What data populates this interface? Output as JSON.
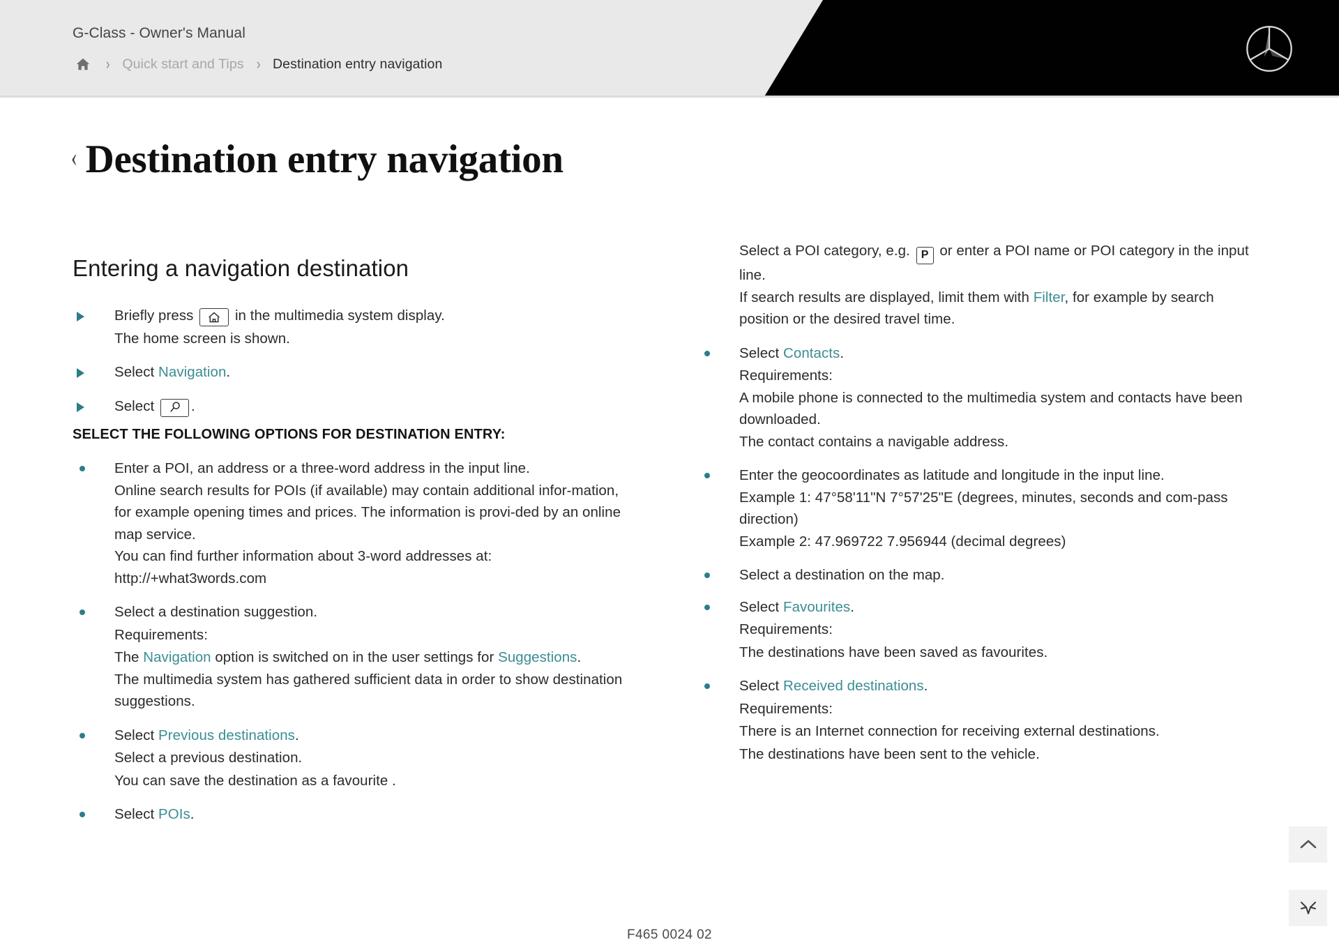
{
  "header": {
    "manual_title": "G-Class - Owner's Manual",
    "breadcrumb": {
      "home_icon": "home-icon",
      "separator": "›",
      "parent": "Quick start and Tips",
      "current": "Destination entry navigation"
    },
    "brand_logo": "mercedes-benz-star-icon"
  },
  "page": {
    "back_chevron": "‹",
    "title": "Destination entry navigation"
  },
  "left_column": {
    "section_heading": "Entering a navigation destination",
    "step1": {
      "prefix": "Briefly press",
      "icon": "home-icon",
      "suffix": "in the multimedia system display.",
      "result": "The home screen is shown."
    },
    "step2": {
      "prefix": "Select",
      "link": "Navigation",
      "period": "."
    },
    "step3": {
      "prefix": "Select",
      "icon": "search-icon",
      "period": "."
    },
    "caps_heading": "SELECT THE FOLLOWING OPTIONS FOR DESTINATION ENTRY:",
    "options": {
      "poi_entry": {
        "line1": "Enter a POI, an address or a three-word address in the input line.",
        "line2": "Online search results for POIs (if available) may contain additional infor-mation, for example opening times and prices. The information is provi-ded by an online map service.",
        "line3": "You can find further information about 3-word addresses at: http://+what3words.com"
      },
      "suggestion": {
        "line1": "Select a destination suggestion.",
        "requirements_label": "Requirements:",
        "req1_before": "The ",
        "req1_link1": "Navigation",
        "req1_middle": " option is switched on in the user settings for ",
        "req1_link2": "Suggestions",
        "req1_after": ".",
        "req2": "The multimedia system has gathered sufficient data in order to show destination suggestions."
      },
      "previous": {
        "prefix": "Select ",
        "link": "Previous destinations",
        "period": ".",
        "line2": "Select a previous destination.",
        "line3": "You can save the destination as a favourite ."
      },
      "pois": {
        "prefix": "Select ",
        "link": "POIs",
        "period": "."
      }
    }
  },
  "right_column": {
    "poi_category": {
      "before": "Select a POI category, e.g.",
      "icon_label": "P",
      "after": "or enter a POI name or POI category in the input line."
    },
    "filter_text": {
      "before": "If search results are displayed, limit them with ",
      "link": "Filter",
      "after": ", for example by search position or the desired travel time."
    },
    "contacts": {
      "prefix": "Select ",
      "link": "Contacts",
      "period": ".",
      "requirements_label": "Requirements:",
      "req1": "A mobile phone is connected to the multimedia system and contacts have been downloaded.",
      "req2": "The contact contains a navigable address."
    },
    "geocoordinates": {
      "line1": "Enter the geocoordinates as latitude and longitude in the input line.",
      "example1": "Example 1: 47°58'11\"N 7°57'25\"E (degrees, minutes, seconds and com-pass direction)",
      "example2": "Example 2: 47.969722 7.956944 (decimal degrees)"
    },
    "map_select": "Select a destination on the map.",
    "favourites": {
      "prefix": "Select ",
      "link": "Favourites",
      "period": ".",
      "requirements_label": "Requirements:",
      "req1": "The destinations have been saved as favourites."
    },
    "received": {
      "prefix": "Select ",
      "link": "Received destinations",
      "period": ".",
      "requirements_label": "Requirements:",
      "req1": "There is an Internet connection for receiving external destinations.",
      "req2": "The destinations have been sent to the vehicle."
    }
  },
  "side_buttons": {
    "scroll_top": "chevron-up-icon",
    "collapse": "collapse-icon"
  },
  "footer": {
    "document_code": "F465 0024 02"
  },
  "colors": {
    "link_teal": "#3b8d94",
    "bullet_teal": "#2d7d8a",
    "header_bg": "#e9e9e9",
    "banner_black": "#010101"
  }
}
